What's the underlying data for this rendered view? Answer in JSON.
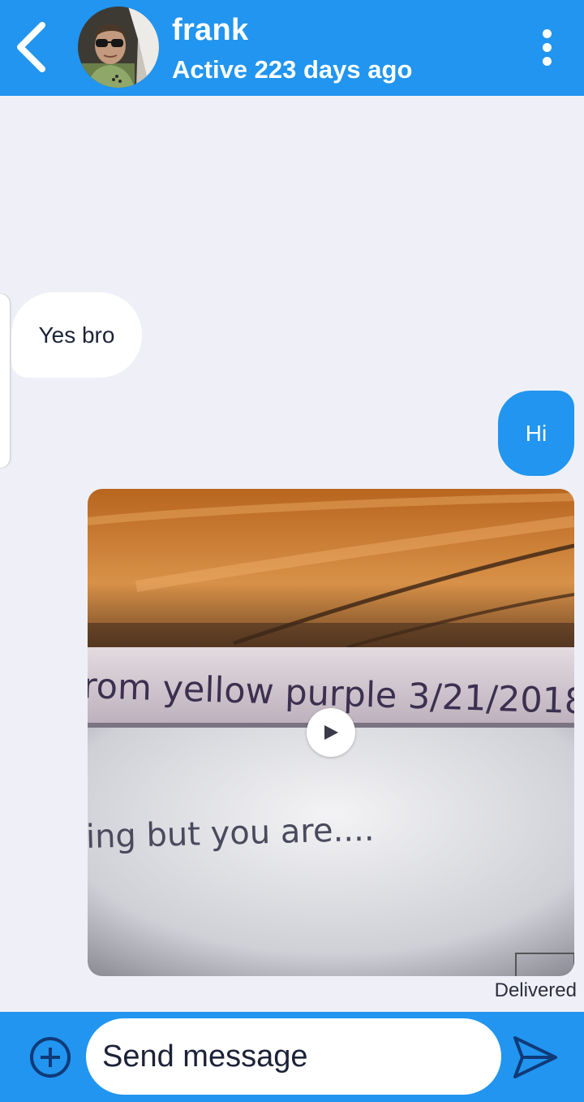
{
  "header": {
    "contact_name": "frank",
    "status": "Active 223 days ago",
    "icons": {
      "back": "chevron-left-icon",
      "menu": "more-vertical-icon"
    },
    "background_color": "#2195ef"
  },
  "messages": [
    {
      "direction": "incoming",
      "type": "text",
      "text": "Yes bro"
    },
    {
      "direction": "outgoing",
      "type": "text",
      "text": "Hi"
    },
    {
      "direction": "outgoing",
      "type": "video",
      "frame_text": [
        "rom yellow purple 3/21/2018",
        "ing but you are...."
      ],
      "icon": "play-icon"
    }
  ],
  "delivery_status": "Delivered",
  "composer": {
    "placeholder": "Send message",
    "icons": {
      "add": "add-circle-icon",
      "send": "send-icon"
    }
  },
  "colors": {
    "accent": "#2195ef",
    "background": "#eff0f7",
    "incoming_bubble": "#ffffff"
  }
}
